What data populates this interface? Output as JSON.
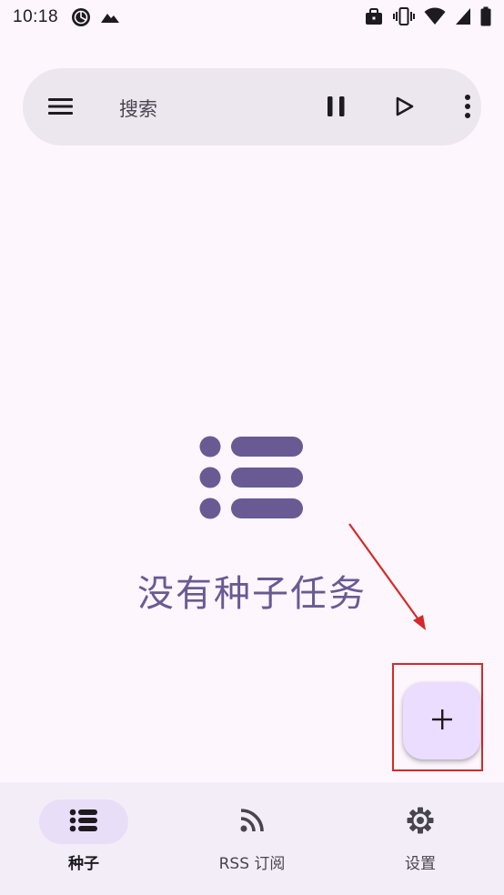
{
  "status_bar": {
    "time": "10:18",
    "left_icons": [
      "pie-chart-icon",
      "mountain-icon"
    ],
    "right_icons": [
      "work-profile-icon",
      "vibrate-icon",
      "wifi-icon",
      "cellular-signal-icon",
      "battery-icon"
    ]
  },
  "search_bar": {
    "placeholder": "搜索",
    "icons": [
      "menu-icon",
      "pause-icon",
      "play-icon",
      "more-vert-icon"
    ]
  },
  "empty_state": {
    "icon": "list-icon",
    "message": "没有种子任务"
  },
  "fab": {
    "icon": "plus-icon"
  },
  "bottom_nav": {
    "items": [
      {
        "label": "种子",
        "icon": "list-icon",
        "active": true
      },
      {
        "label": "RSS 订阅",
        "icon": "rss-icon",
        "active": false
      },
      {
        "label": "设置",
        "icon": "settings-gear-icon",
        "active": false
      }
    ]
  },
  "colors": {
    "background": "#fdf7fd",
    "search_bar": "#ece6ee",
    "accent": "#6a5a93",
    "fab": "#eaddff",
    "nav_bar": "#f3edf7",
    "nav_active_pill": "#e8def8",
    "annotation": "#d62828"
  }
}
